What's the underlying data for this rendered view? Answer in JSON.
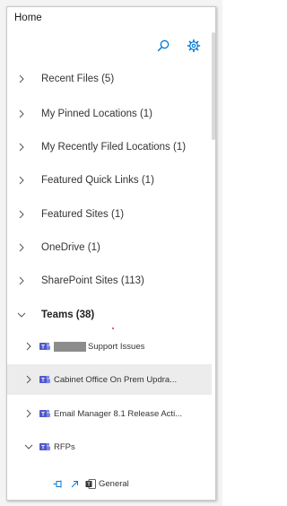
{
  "header": {
    "title": "Home"
  },
  "toolbar": {
    "search_icon": "search-icon",
    "settings_icon": "gear-icon"
  },
  "nav": {
    "items": [
      {
        "label": "Recent Files (5)",
        "expanded": false
      },
      {
        "label": "My Pinned Locations (1)",
        "expanded": false
      },
      {
        "label": "My Recently Filed Locations (1)",
        "expanded": false
      },
      {
        "label": "Featured Quick Links (1)",
        "expanded": false
      },
      {
        "label": "Featured Sites (1)",
        "expanded": false
      },
      {
        "label": "OneDrive (1)",
        "expanded": false
      },
      {
        "label": "SharePoint Sites (113)",
        "expanded": false
      },
      {
        "label": "Teams (38)",
        "expanded": true
      }
    ]
  },
  "teams": {
    "items": [
      {
        "label": "Support Issues",
        "redacted_prefix": true,
        "expanded": false,
        "selected": false
      },
      {
        "label": "Cabinet Office On Prem Updra...",
        "expanded": false,
        "selected": true
      },
      {
        "label": "Email Manager 8.1 Release Acti...",
        "expanded": false,
        "selected": false
      },
      {
        "label": "RFPs",
        "expanded": true,
        "selected": false
      }
    ],
    "channel": {
      "label": "General",
      "icons": [
        "pin-icon",
        "open-link-icon",
        "teams-channel-icon"
      ]
    }
  },
  "colors": {
    "accent": "#0078d4",
    "teams_purple": "#5059c9",
    "selected_bg": "#ececec"
  }
}
